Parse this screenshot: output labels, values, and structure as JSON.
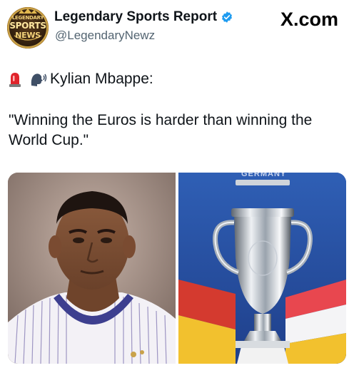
{
  "account": {
    "display_name": "Legendary Sports Report",
    "handle": "@LegendaryNewz",
    "avatar_text": [
      "LEGENDARY",
      "SPORTS",
      "NEWS"
    ],
    "verified": true,
    "verified_color": "#1d9bf0"
  },
  "brand": "X.com",
  "tweet": {
    "speaker": "Kylian Mbappe:",
    "quote": "\"Winning the Euros is harder than winning the World Cup.\"",
    "icons": [
      "siren-icon",
      "speaking-head-icon"
    ]
  },
  "media": {
    "right_photo_caption": "GERMANY"
  }
}
